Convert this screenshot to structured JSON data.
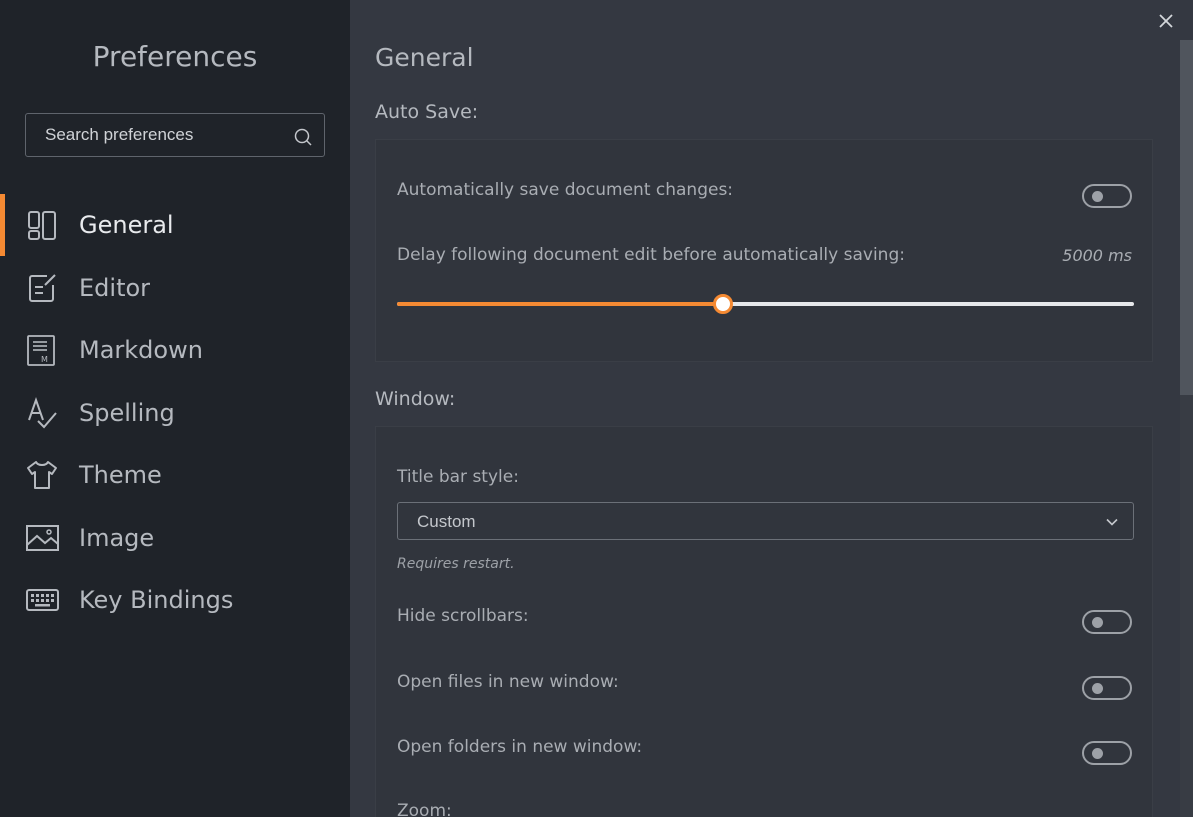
{
  "sidebar": {
    "title": "Preferences",
    "search_placeholder": "Search preferences",
    "items": [
      {
        "label": "General",
        "icon": "general-icon"
      },
      {
        "label": "Editor",
        "icon": "editor-icon"
      },
      {
        "label": "Markdown",
        "icon": "markdown-icon"
      },
      {
        "label": "Spelling",
        "icon": "spelling-icon"
      },
      {
        "label": "Theme",
        "icon": "theme-icon"
      },
      {
        "label": "Image",
        "icon": "image-icon"
      },
      {
        "label": "Key Bindings",
        "icon": "keyboard-icon"
      }
    ],
    "active_item": "General"
  },
  "main": {
    "title": "General",
    "auto_save": {
      "section_title": "Auto Save:",
      "auto_save_label": "Automatically save document changes:",
      "auto_save_enabled": false,
      "delay_label": "Delay following document edit before automatically saving:",
      "delay_value": "5000 ms",
      "delay_fraction": 0.443
    },
    "window": {
      "section_title": "Window:",
      "title_bar_label": "Title bar style:",
      "title_bar_value": "Custom",
      "restart_note": "Requires restart.",
      "hide_scrollbars_label": "Hide scrollbars:",
      "hide_scrollbars_enabled": false,
      "open_files_label": "Open files in new window:",
      "open_files_enabled": false,
      "open_folders_label": "Open folders in new window:",
      "open_folders_enabled": false,
      "zoom_label": "Zoom:"
    }
  },
  "colors": {
    "accent": "#f58a33",
    "sidebar_bg": "#1f2329",
    "main_bg": "#343841"
  }
}
